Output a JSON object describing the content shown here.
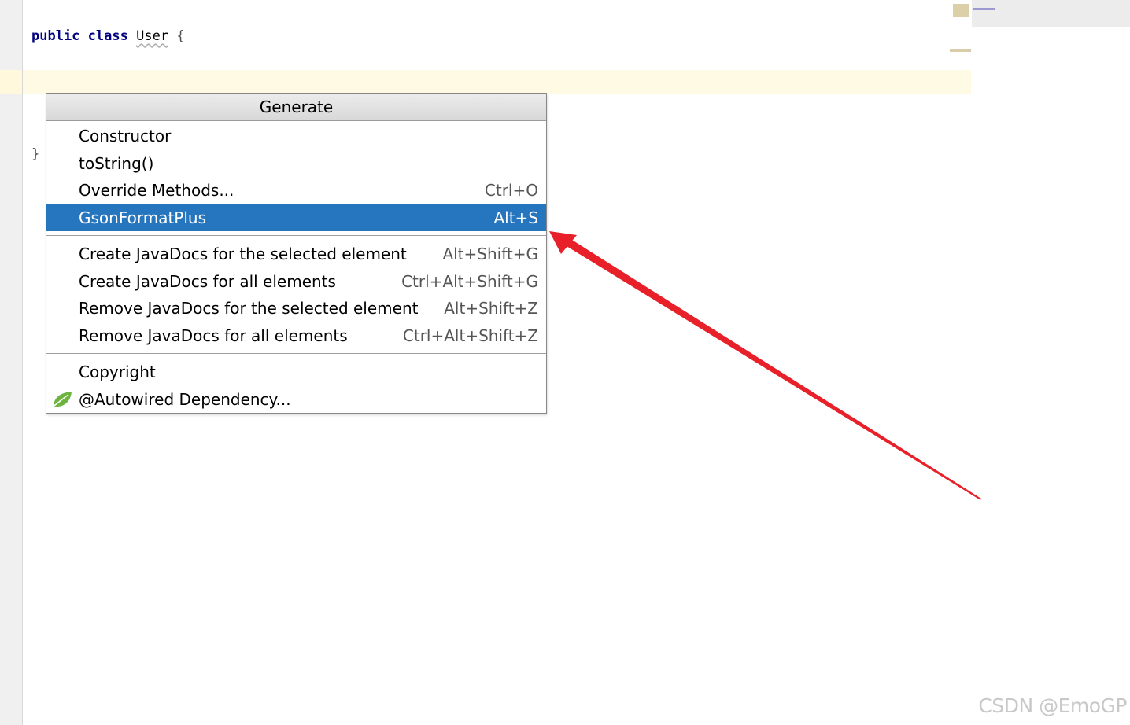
{
  "editor": {
    "line1": {
      "keyword1": "public",
      "keyword2": "class",
      "class_name": "User",
      "open_brace": "{"
    },
    "line3": {
      "close_brace": "}"
    }
  },
  "popup": {
    "title": "Generate",
    "group1": [
      {
        "label": "Constructor",
        "shortcut": ""
      },
      {
        "label": "toString()",
        "shortcut": ""
      },
      {
        "label": "Override Methods...",
        "shortcut": "Ctrl+O"
      },
      {
        "label": "GsonFormatPlus",
        "shortcut": "Alt+S"
      }
    ],
    "group2": [
      {
        "label": "Create JavaDocs for the selected element",
        "shortcut": "Alt+Shift+G"
      },
      {
        "label": "Create JavaDocs for all elements",
        "shortcut": "Ctrl+Alt+Shift+G"
      },
      {
        "label": "Remove JavaDocs for the selected element",
        "shortcut": "Alt+Shift+Z"
      },
      {
        "label": "Remove JavaDocs for all elements",
        "shortcut": "Ctrl+Alt+Shift+Z"
      }
    ],
    "group3": [
      {
        "label": "Copyright",
        "shortcut": ""
      },
      {
        "label": "@Autowired Dependency...",
        "shortcut": "",
        "icon": "spring-leaf-icon"
      }
    ]
  },
  "colors": {
    "selection": "#2675bf",
    "annotation_arrow": "#e8202a",
    "spring_leaf": "#6db33f"
  },
  "watermark": "CSDN @EmoGP"
}
